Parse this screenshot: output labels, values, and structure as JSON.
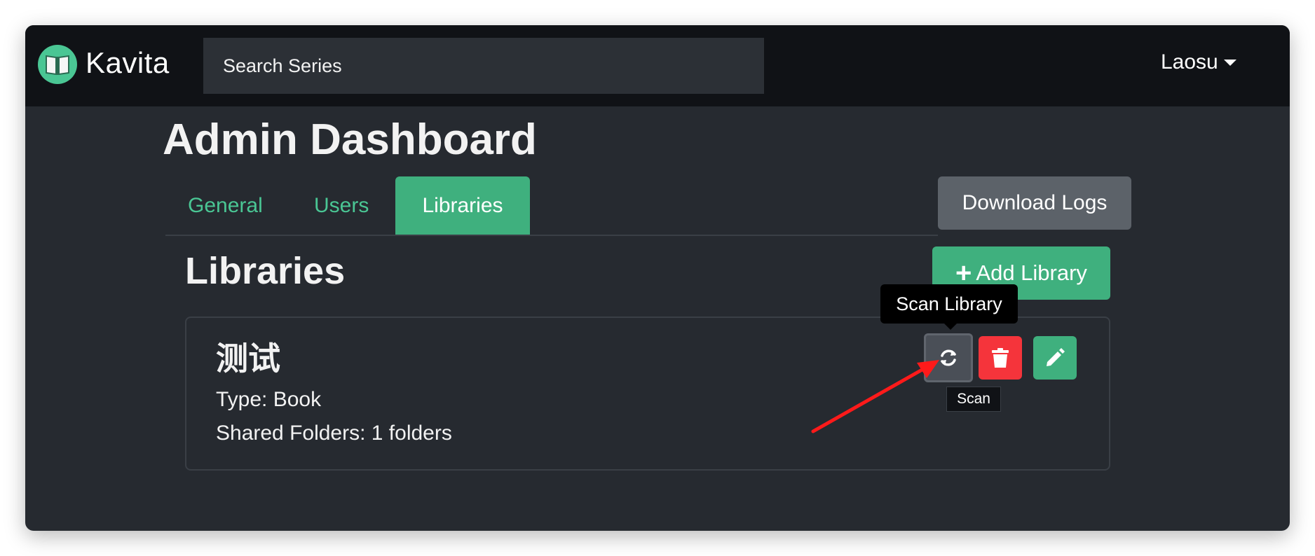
{
  "brand": {
    "name": "Kavita"
  },
  "search": {
    "placeholder": "Search Series"
  },
  "user": {
    "name": "Laosu"
  },
  "page": {
    "title": "Admin Dashboard"
  },
  "tabs": [
    {
      "label": "General",
      "active": false
    },
    {
      "label": "Users",
      "active": false
    },
    {
      "label": "Libraries",
      "active": true
    }
  ],
  "actions": {
    "download_logs": "Download Logs",
    "add_library": "Add Library",
    "add_icon": "+"
  },
  "libraries_section": {
    "title": "Libraries"
  },
  "library": {
    "name": "测试",
    "type": "Type: Book",
    "folders": "Shared Folders: 1 folders"
  },
  "tooltips": {
    "scan_library": "Scan Library",
    "scan": "Scan"
  },
  "icons": [
    "book-icon",
    "refresh-icon",
    "trash-icon",
    "pencil-icon",
    "caret-down-icon"
  ],
  "colors": {
    "accent": "#4ac694",
    "danger": "#f5343b",
    "navbar": "#101216",
    "background": "#262a30",
    "secondary": "#5c6269",
    "annotation": "#ff1a1a"
  }
}
